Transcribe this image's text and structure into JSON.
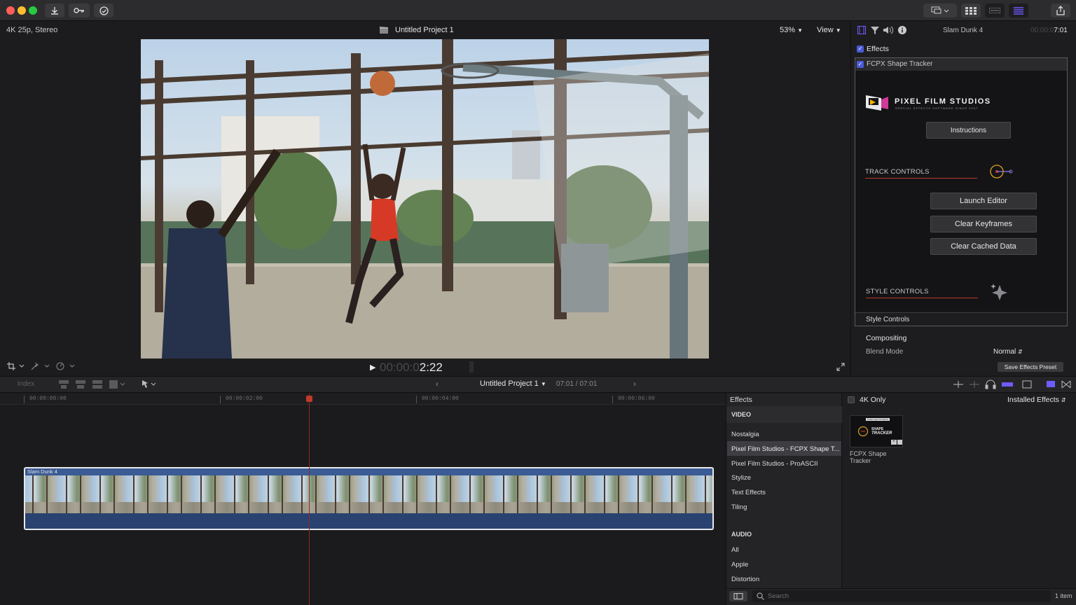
{
  "toolbar": {
    "import_icon": "download-icon",
    "keyword_icon": "key-icon",
    "check_icon": "checkmark-icon",
    "share_icon": "share-icon"
  },
  "viewer": {
    "format": "4K 25p, Stereo",
    "project_title": "Untitled Project 1",
    "zoom": "53%",
    "view_menu": "View",
    "timecode_dim": "00:00:0",
    "timecode_bright": "2:22"
  },
  "inspector": {
    "clip_name": "Slam Dunk 4",
    "duration_dim": "00:00:0",
    "duration_bright": "7:01",
    "effects_label": "Effects",
    "plugin_name": "FCPX Shape Tracker",
    "brand_name": "PIXEL FILM STUDIOS",
    "brand_tagline": "SPECIAL EFFECTS SOFTWARE SINCE 2007",
    "instructions_button": "Instructions",
    "track_controls": "TRACK CONTROLS",
    "launch_editor": "Launch Editor",
    "clear_keyframes": "Clear Keyframes",
    "clear_cached": "Clear Cached Data",
    "style_controls": "STYLE CONTROLS",
    "style_controls_row": "Style Controls",
    "compositing": "Compositing",
    "blend_mode_label": "Blend Mode",
    "blend_mode_value": "Normal",
    "save_preset": "Save Effects Preset"
  },
  "timeline": {
    "index_label": "Index",
    "project_title": "Untitled Project 1",
    "position": "07:01 / 07:01",
    "ruler": [
      "00:00:00:00",
      "00:00:02:00",
      "00:00:04:00",
      "00:00:06:00"
    ],
    "clip_label": "Slam Dunk 4"
  },
  "browser": {
    "title": "Effects",
    "filter_label": "4K Only",
    "installed": "Installed Effects",
    "video_header": "VIDEO",
    "video_items": [
      "Nostalgia",
      "Pixel Film Studios - FCPX Shape T...",
      "Pixel Film Studios - ProASCII",
      "Stylize",
      "Text Effects",
      "Tiling"
    ],
    "audio_header": "AUDIO",
    "audio_items": [
      "All",
      "Apple",
      "Distortion"
    ],
    "thumb_line1": "FCPX Shape",
    "thumb_line2": "Tracker",
    "thumb_badge": "PIXEL FILM STUDIOS",
    "thumb_art1": "SHAPE",
    "thumb_art2": "TRACKER",
    "search_placeholder": "Search",
    "count": "1 item"
  },
  "colors": {
    "accent": "#6e5cff",
    "selection": "#3d3d42",
    "clip_blue": "#2a4270",
    "playhead": "#c0392b"
  }
}
